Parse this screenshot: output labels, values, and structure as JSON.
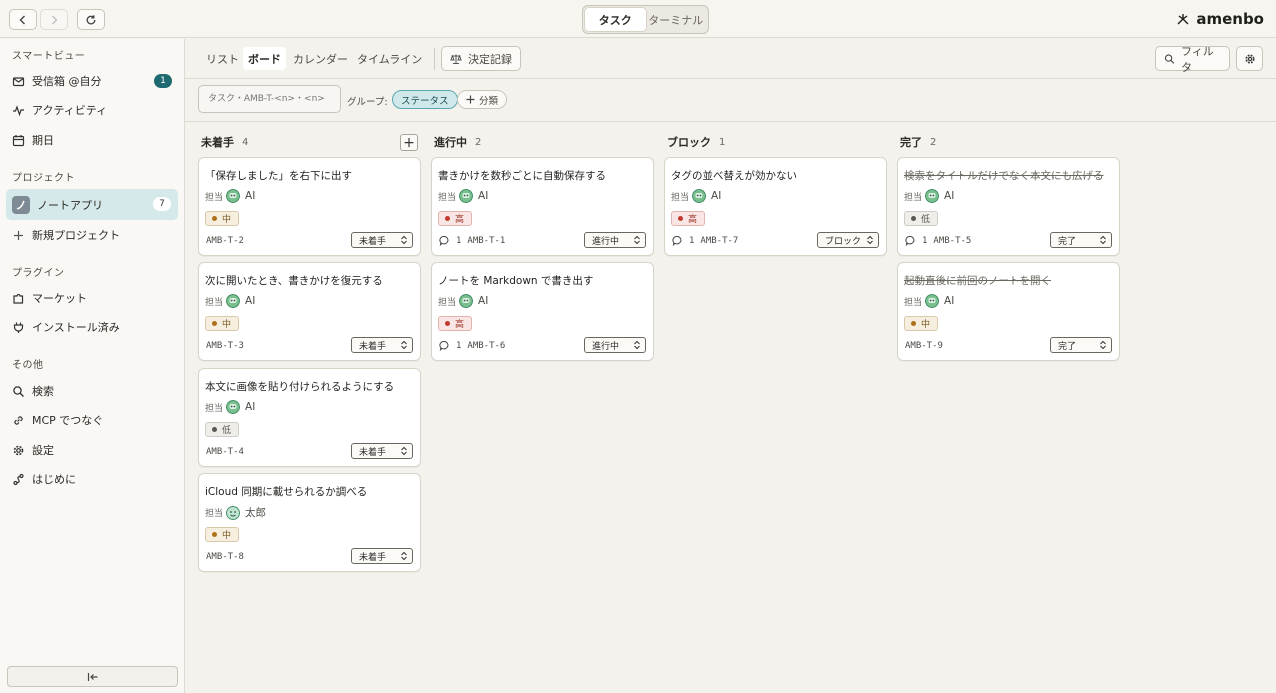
{
  "topbar": {
    "segments": [
      "タスク",
      "ターミナル"
    ],
    "active_segment": 0,
    "brand": "amenbo"
  },
  "sidebar": {
    "sections": {
      "smart": "スマートビュー",
      "project": "プロジェクト",
      "plugin": "プラグイン",
      "other": "その他"
    },
    "smart_items": [
      {
        "label": "受信箱 @自分",
        "badge": "1"
      },
      {
        "label": "アクティビティ"
      },
      {
        "label": "期日"
      }
    ],
    "project_items": [
      {
        "label": "ノートアプリ",
        "icon_text": "ノ",
        "badge": "7"
      },
      {
        "label": "新規プロジェクト"
      }
    ],
    "plugin_items": [
      {
        "label": "マーケット"
      },
      {
        "label": "インストール済み"
      }
    ],
    "other_items": [
      {
        "label": "検索"
      },
      {
        "label": "MCP でつなぐ"
      },
      {
        "label": "設定"
      },
      {
        "label": "はじめに"
      }
    ]
  },
  "viewbar": {
    "tabs": [
      "リスト",
      "ボード",
      "カレンダー",
      "タイムライン"
    ],
    "active_tab": 1,
    "decisions": "決定記録",
    "filter": "フィルタ"
  },
  "filterbar": {
    "task_placeholder": "タスク・AMB-T-<n>・<n>",
    "group_label": "グループ:",
    "group_chip": "ステータス",
    "add_chip": "分類"
  },
  "columns": [
    {
      "title": "未着手",
      "count": "4"
    },
    {
      "title": "進行中",
      "count": "2"
    },
    {
      "title": "ブロック",
      "count": "1"
    },
    {
      "title": "完了",
      "count": "2"
    }
  ],
  "assignee_label": "担当",
  "cards": [
    {
      "title": "「保存しました」を右下に出す",
      "assignee": "AI",
      "priority": "中",
      "comments": "",
      "id": "AMB-T-2",
      "status": "未着手"
    },
    {
      "title": "次に開いたとき、書きかけを復元する",
      "assignee": "AI",
      "priority": "中",
      "comments": "",
      "id": "AMB-T-3",
      "status": "未着手"
    },
    {
      "title": "本文に画像を貼り付けられるようにする",
      "assignee": "AI",
      "priority": "低",
      "comments": "",
      "id": "AMB-T-4",
      "status": "未着手"
    },
    {
      "title": "iCloud 同期に載せられるか調べる",
      "assignee": "太郎",
      "priority": "中",
      "comments": "",
      "id": "AMB-T-8",
      "status": "未着手"
    },
    {
      "title": "書きかけを数秒ごとに自動保存する",
      "assignee": "AI",
      "priority": "高",
      "comments": "1",
      "id": "AMB-T-1",
      "status": "進行中"
    },
    {
      "title": "ノートを Markdown で書き出す",
      "assignee": "AI",
      "priority": "高",
      "comments": "1",
      "id": "AMB-T-6",
      "status": "進行中"
    },
    {
      "title": "タグの並べ替えが効かない",
      "assignee": "AI",
      "priority": "高",
      "comments": "1",
      "id": "AMB-T-7",
      "status": "ブロック"
    },
    {
      "title": "検索をタイトルだけでなく本文にも広げる",
      "assignee": "AI",
      "priority": "低",
      "comments": "1",
      "id": "AMB-T-5",
      "status": "完了"
    },
    {
      "title": "起動直後に前回のノートを開く",
      "assignee": "AI",
      "priority": "中",
      "comments": "",
      "id": "AMB-T-9",
      "status": "完了"
    }
  ],
  "colors": {
    "accent": "#1f6a70",
    "priority_high": "#c0392b",
    "priority_mid": "#b0701a",
    "priority_low": "#5a5852"
  }
}
